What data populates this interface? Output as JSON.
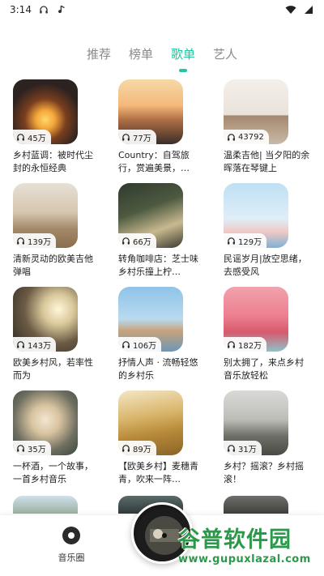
{
  "status_bar": {
    "time": "3:14",
    "headphone_icon": "headphone-icon",
    "tiktok_icon": "music-note-icon",
    "wifi_icon": "wifi-icon",
    "signal_icon": "signal-icon"
  },
  "tabs": [
    {
      "label": "推荐",
      "active": false
    },
    {
      "label": "榜单",
      "active": false
    },
    {
      "label": "歌单",
      "active": true
    },
    {
      "label": "艺人",
      "active": false
    }
  ],
  "accent_color": "#22c79d",
  "playlists": [
    {
      "count": "45万",
      "title": "乡村蓝调：被时代尘封的永恒经典"
    },
    {
      "count": "77万",
      "title": "Country：自驾旅行，赏遍美景，…"
    },
    {
      "count": "43792",
      "title": "温柔吉他| 当夕阳的余晖落在琴键上"
    },
    {
      "count": "139万",
      "title": "清新灵动的欧美吉他弹唱"
    },
    {
      "count": "66万",
      "title": "转角咖啡店：芝士味乡村乐撞上柠…"
    },
    {
      "count": "129万",
      "title": "民谣岁月|放空思绪，去感受风"
    },
    {
      "count": "143万",
      "title": "欧美乡村风，若率性而为"
    },
    {
      "count": "106万",
      "title": "抒情人声 · 流畅轻悠的乡村乐"
    },
    {
      "count": "182万",
      "title": "别太拥了，来点乡村音乐放轻松"
    },
    {
      "count": "35万",
      "title": "一杯酒，一个故事，一首乡村音乐"
    },
    {
      "count": "89万",
      "title": "【欧美乡村】麦穗青青，吹来一阵…"
    },
    {
      "count": "31万",
      "title": "乡村？摇滚？乡村摇滚！"
    }
  ],
  "bottom_nav": {
    "music_circle_label": "音乐圈"
  },
  "watermark": {
    "main": "谷普软件园",
    "sub": "www.gupuxlazal.com"
  }
}
